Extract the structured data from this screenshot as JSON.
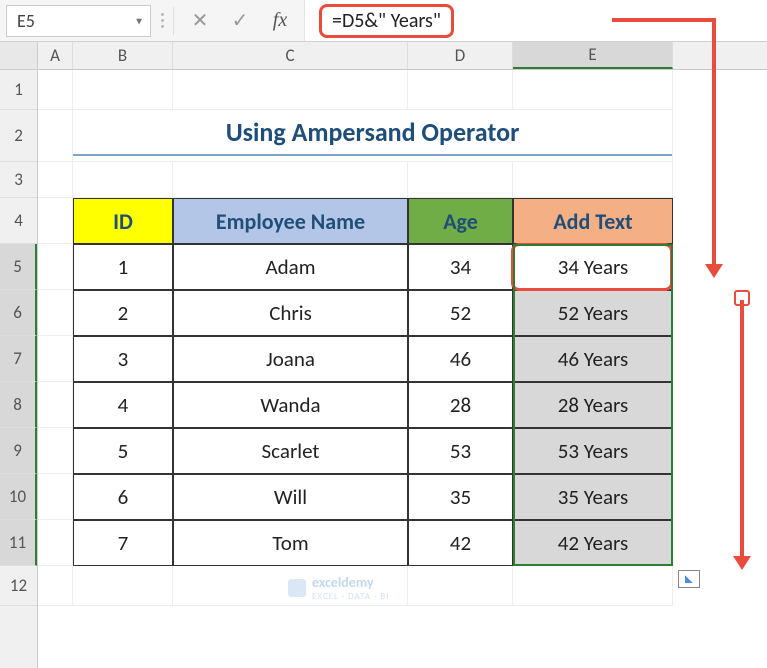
{
  "name_box": "E5",
  "formula": "=D5&\" Years\"",
  "fb_cancel": "✕",
  "fb_enter": "✓",
  "fb_fx": "fx",
  "columns": [
    "A",
    "B",
    "C",
    "D",
    "E"
  ],
  "rows": [
    "1",
    "2",
    "3",
    "4",
    "5",
    "6",
    "7",
    "8",
    "9",
    "10",
    "11",
    "12"
  ],
  "title": "Using Ampersand Operator",
  "headers": {
    "id": "ID",
    "name": "Employee Name",
    "age": "Age",
    "add": "Add Text"
  },
  "table": [
    {
      "id": "1",
      "name": "Adam",
      "age": "34",
      "add": "34 Years"
    },
    {
      "id": "2",
      "name": "Chris",
      "age": "52",
      "add": "52 Years"
    },
    {
      "id": "3",
      "name": "Joana",
      "age": "46",
      "add": "46 Years"
    },
    {
      "id": "4",
      "name": "Wanda",
      "age": "28",
      "add": "28 Years"
    },
    {
      "id": "5",
      "name": "Scarlet",
      "age": "53",
      "add": "53 Years"
    },
    {
      "id": "6",
      "name": "Will",
      "age": "35",
      "add": "35 Years"
    },
    {
      "id": "7",
      "name": "Tom",
      "age": "42",
      "add": "42 Years"
    }
  ],
  "watermark": {
    "brand": "exceldemy",
    "tag": "EXCEL · DATA · BI"
  },
  "chart_data": {
    "type": "table",
    "columns": [
      "ID",
      "Employee Name",
      "Age",
      "Add Text"
    ],
    "rows": [
      [
        "1",
        "Adam",
        34,
        "34 Years"
      ],
      [
        "2",
        "Chris",
        52,
        "52 Years"
      ],
      [
        "3",
        "Joana",
        46,
        "46 Years"
      ],
      [
        "4",
        "Wanda",
        28,
        "28 Years"
      ],
      [
        "5",
        "Scarlet",
        53,
        "53 Years"
      ],
      [
        "6",
        "Will",
        35,
        "35 Years"
      ],
      [
        "7",
        "Tom",
        42,
        "42 Years"
      ]
    ],
    "title": "Using Ampersand Operator"
  }
}
